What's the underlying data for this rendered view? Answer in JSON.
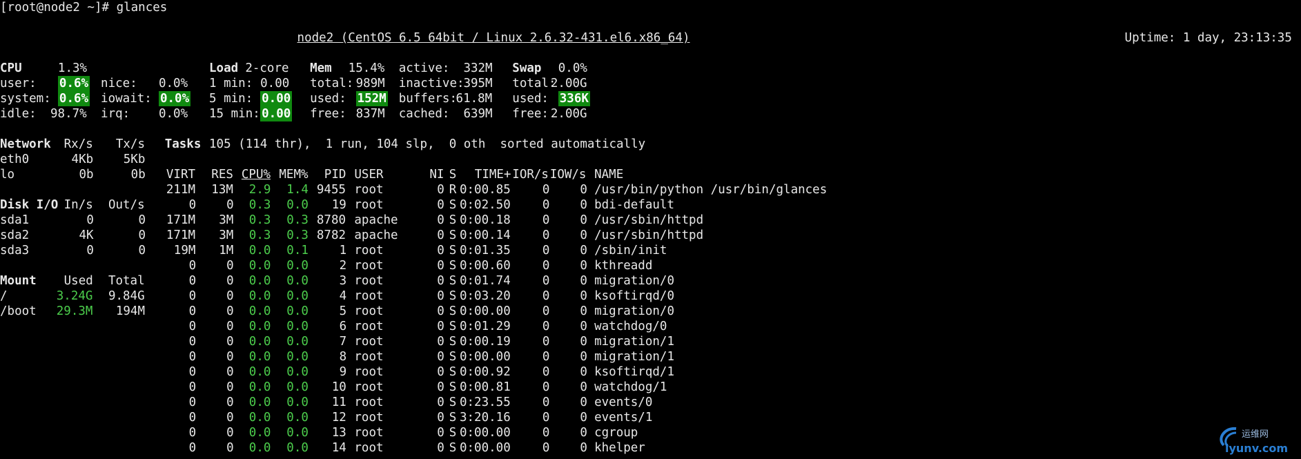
{
  "prompt": "[root@node2 ~]# glances",
  "title": "node2 (CentOS 6.5 64bit / Linux 2.6.32-431.el6.x86_64)",
  "uptime": "Uptime: 1 day, 23:13:35",
  "cpu": {
    "label": "CPU",
    "total": "1.3%",
    "rows": [
      {
        "k": "user:",
        "v": "0.6%",
        "hl": true
      },
      {
        "k": "system:",
        "v": "0.6%",
        "hl": true
      },
      {
        "k": "idle:",
        "v": "98.7%",
        "hl": false
      }
    ],
    "rows2": [
      {
        "k": "nice:",
        "v": "0.0%",
        "hl": false
      },
      {
        "k": "iowait:",
        "v": "0.0%",
        "hl": true
      },
      {
        "k": "irq:",
        "v": "0.0%",
        "hl": false
      }
    ]
  },
  "load": {
    "label": "Load",
    "cores": "2-core",
    "rows": [
      {
        "k": "1 min:",
        "v": "0.00",
        "hl": false
      },
      {
        "k": "5 min:",
        "v": "0.00",
        "hl": true
      },
      {
        "k": "15 min:",
        "v": "0.00",
        "hl": true
      }
    ]
  },
  "mem": {
    "label": "Mem",
    "total": "15.4%",
    "rows": [
      {
        "k": "total:",
        "v": "989M",
        "hl": false
      },
      {
        "k": "used:",
        "v": "152M",
        "hl": true
      },
      {
        "k": "free:",
        "v": "837M",
        "hl": false
      }
    ],
    "rows2": [
      {
        "k": "active:",
        "v": "332M"
      },
      {
        "k": "inactive:",
        "v": "395M"
      },
      {
        "k": "buffers:",
        "v": "61.8M"
      },
      {
        "k": "cached:",
        "v": "639M"
      }
    ]
  },
  "swap": {
    "label": "Swap",
    "total": "0.0%",
    "rows": [
      {
        "k": "total:",
        "v": "2.00G",
        "hl": false
      },
      {
        "k": "used:",
        "v": "336K",
        "hl": true
      },
      {
        "k": "free:",
        "v": "2.00G",
        "hl": false
      }
    ]
  },
  "network": {
    "headers": [
      "Network",
      "Rx/s",
      "Tx/s"
    ],
    "rows": [
      [
        "eth0",
        "4Kb",
        "5Kb"
      ],
      [
        "lo",
        "0b",
        "0b"
      ]
    ]
  },
  "disk": {
    "headers": [
      "Disk I/O",
      "In/s",
      "Out/s"
    ],
    "rows": [
      [
        "sda1",
        "0",
        "0"
      ],
      [
        "sda2",
        "4K",
        "0"
      ],
      [
        "sda3",
        "0",
        "0"
      ]
    ]
  },
  "mount": {
    "headers": [
      "Mount",
      "Used",
      "Total"
    ],
    "rows": [
      [
        "/",
        "3.24G",
        "9.84G"
      ],
      [
        "/boot",
        "29.3M",
        "194M"
      ]
    ]
  },
  "tasks": {
    "label": "Tasks",
    "summary": "105 (114 thr),  1 run, 104 slp,  0 oth  sorted automatically"
  },
  "proc_headers": [
    "VIRT",
    "RES",
    "CPU%",
    "MEM%",
    "PID",
    "USER",
    "NI",
    "S",
    "TIME+",
    "IOR/s",
    "IOW/s",
    "NAME"
  ],
  "processes": [
    [
      "211M",
      "13M",
      "2.9",
      "1.4",
      "9455",
      "root",
      "0",
      "R",
      "0:00.85",
      "0",
      "0",
      "/usr/bin/python /usr/bin/glances"
    ],
    [
      "0",
      "0",
      "0.3",
      "0.0",
      "19",
      "root",
      "0",
      "S",
      "0:02.50",
      "0",
      "0",
      "bdi-default"
    ],
    [
      "171M",
      "3M",
      "0.3",
      "0.3",
      "8780",
      "apache",
      "0",
      "S",
      "0:00.18",
      "0",
      "0",
      "/usr/sbin/httpd"
    ],
    [
      "171M",
      "3M",
      "0.3",
      "0.3",
      "8782",
      "apache",
      "0",
      "S",
      "0:00.14",
      "0",
      "0",
      "/usr/sbin/httpd"
    ],
    [
      "19M",
      "1M",
      "0.0",
      "0.1",
      "1",
      "root",
      "0",
      "S",
      "0:01.35",
      "0",
      "0",
      "/sbin/init"
    ],
    [
      "0",
      "0",
      "0.0",
      "0.0",
      "2",
      "root",
      "0",
      "S",
      "0:00.60",
      "0",
      "0",
      "kthreadd"
    ],
    [
      "0",
      "0",
      "0.0",
      "0.0",
      "3",
      "root",
      "0",
      "S",
      "0:01.74",
      "0",
      "0",
      "migration/0"
    ],
    [
      "0",
      "0",
      "0.0",
      "0.0",
      "4",
      "root",
      "0",
      "S",
      "0:03.20",
      "0",
      "0",
      "ksoftirqd/0"
    ],
    [
      "0",
      "0",
      "0.0",
      "0.0",
      "5",
      "root",
      "0",
      "S",
      "0:00.00",
      "0",
      "0",
      "migration/0"
    ],
    [
      "0",
      "0",
      "0.0",
      "0.0",
      "6",
      "root",
      "0",
      "S",
      "0:01.29",
      "0",
      "0",
      "watchdog/0"
    ],
    [
      "0",
      "0",
      "0.0",
      "0.0",
      "7",
      "root",
      "0",
      "S",
      "0:00.19",
      "0",
      "0",
      "migration/1"
    ],
    [
      "0",
      "0",
      "0.0",
      "0.0",
      "8",
      "root",
      "0",
      "S",
      "0:00.00",
      "0",
      "0",
      "migration/1"
    ],
    [
      "0",
      "0",
      "0.0",
      "0.0",
      "9",
      "root",
      "0",
      "S",
      "0:00.92",
      "0",
      "0",
      "ksoftirqd/1"
    ],
    [
      "0",
      "0",
      "0.0",
      "0.0",
      "10",
      "root",
      "0",
      "S",
      "0:00.81",
      "0",
      "0",
      "watchdog/1"
    ],
    [
      "0",
      "0",
      "0.0",
      "0.0",
      "11",
      "root",
      "0",
      "S",
      "0:23.55",
      "0",
      "0",
      "events/0"
    ],
    [
      "0",
      "0",
      "0.0",
      "0.0",
      "12",
      "root",
      "0",
      "S",
      "3:20.16",
      "0",
      "0",
      "events/1"
    ],
    [
      "0",
      "0",
      "0.0",
      "0.0",
      "13",
      "root",
      "0",
      "S",
      "0:00.00",
      "0",
      "0",
      "cgroup"
    ],
    [
      "0",
      "0",
      "0.0",
      "0.0",
      "14",
      "root",
      "0",
      "S",
      "0:00.00",
      "0",
      "0",
      "khelper"
    ]
  ],
  "watermark": {
    "top": "运维网",
    "bottom": "iyunv.com",
    "color": "#2a7fd4"
  }
}
